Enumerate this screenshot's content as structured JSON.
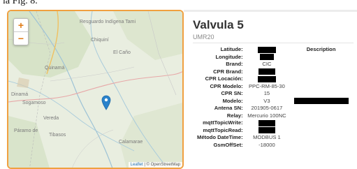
{
  "caption": "la Fig. 8.",
  "map": {
    "zoom_in": "+",
    "zoom_out": "−",
    "places": {
      "a": "Resguardo Indígena Tami",
      "b": "Chiquiní",
      "c": "El Caño",
      "d": "Quinamá",
      "e": "Dinamá",
      "f": "Sogamoso",
      "g": "Vereda",
      "h": "Páramo de",
      "i": "Tibasos",
      "j": "Calamarae"
    },
    "attribution_leaflet": "Leaflet",
    "attribution_rest": "| © OpenStreetMap"
  },
  "detail": {
    "title": "Valvula 5",
    "subtitle": "UMR20",
    "description_header": "Description",
    "rows": [
      {
        "label": "Latitude:",
        "value": ""
      },
      {
        "label": "Longitude:",
        "value": ""
      },
      {
        "label": "Brand:",
        "value": "CIC"
      },
      {
        "label": "CPR Brand:",
        "value": ""
      },
      {
        "label": "CPR Locación:",
        "value": ""
      },
      {
        "label": "CPR Modelo:",
        "value": "PPC-RM-85-30"
      },
      {
        "label": "CPR SN:",
        "value": "15"
      },
      {
        "label": "Modelo:",
        "value": "V3"
      },
      {
        "label": "Antena SN:",
        "value": "201905-0617"
      },
      {
        "label": "Relay:",
        "value": "Mercurio 100NC"
      },
      {
        "label": "mqttTopicWrite:",
        "value": ""
      },
      {
        "label": "mqttTopicRead:",
        "value": ""
      },
      {
        "label": "Método DateTime:",
        "value": "MODBUS 1"
      },
      {
        "label": "GsmOffSet:",
        "value": "-18000"
      }
    ]
  }
}
